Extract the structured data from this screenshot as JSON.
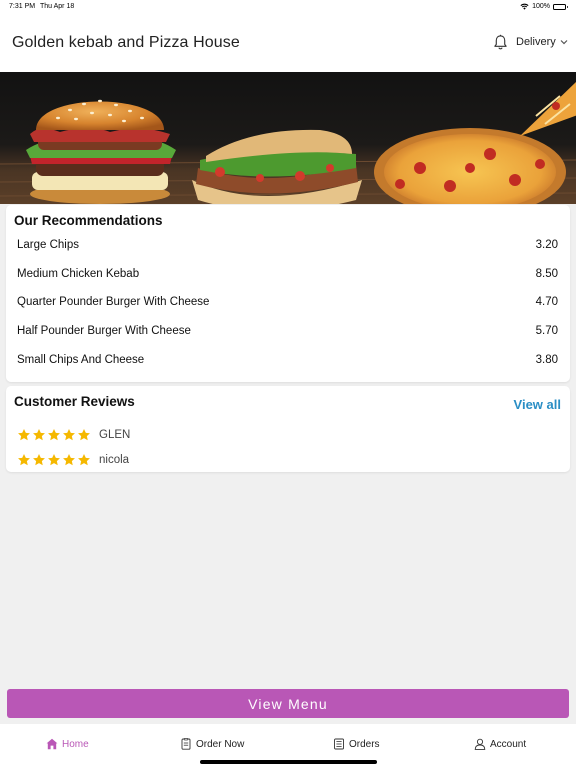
{
  "status_bar": {
    "time": "7:31 PM",
    "date": "Thu Apr 18",
    "battery": "100%"
  },
  "header": {
    "title": "Golden kebab and Pizza House",
    "delivery_label": "Delivery"
  },
  "recommendations": {
    "title": "Our Recommendations",
    "items": [
      {
        "name": "Large Chips",
        "price": "3.20"
      },
      {
        "name": "Medium Chicken Kebab",
        "price": "8.50"
      },
      {
        "name": "Quarter Pounder Burger With Cheese",
        "price": "4.70"
      },
      {
        "name": "Half Pounder Burger With Cheese",
        "price": "5.70"
      },
      {
        "name": "Small Chips And Cheese",
        "price": "3.80"
      }
    ]
  },
  "reviews": {
    "title": "Customer Reviews",
    "view_all": "View all",
    "items": [
      {
        "name": "GLEN",
        "rating": 5
      },
      {
        "name": "nicola",
        "rating": 5
      }
    ]
  },
  "view_menu_label": "View Menu",
  "tabs": [
    {
      "label": "Home",
      "icon": "home-icon",
      "active": true
    },
    {
      "label": "Order Now",
      "icon": "order-icon",
      "active": false
    },
    {
      "label": "Orders",
      "icon": "orders-list-icon",
      "active": false
    },
    {
      "label": "Account",
      "icon": "account-icon",
      "active": false
    }
  ],
  "colors": {
    "accent": "#b957b6",
    "link": "#2a8ec5",
    "star": "#f5b800"
  }
}
